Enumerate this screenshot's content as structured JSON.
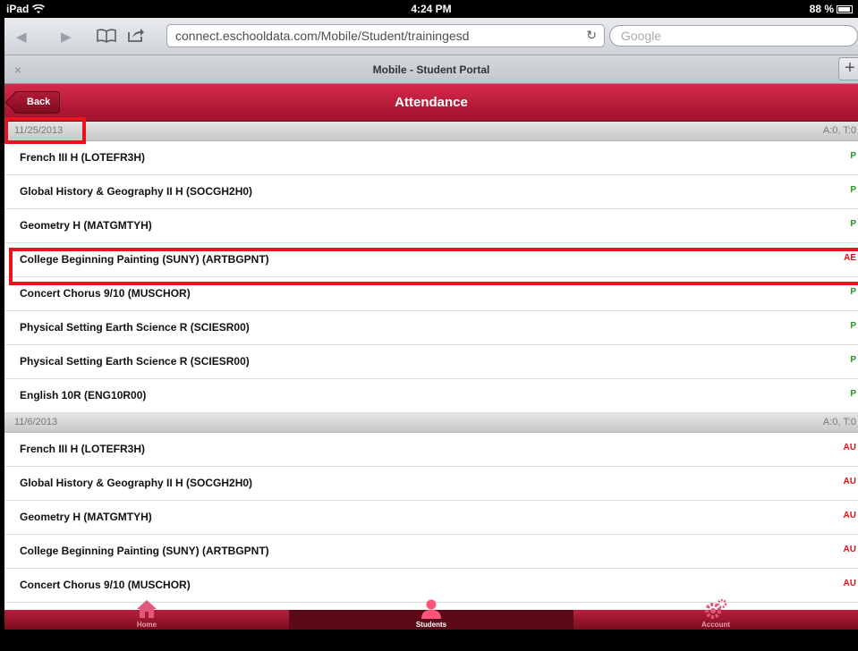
{
  "status_bar": {
    "device": "iPad",
    "time": "4:24 PM",
    "battery": "88 %"
  },
  "browser": {
    "url": "connect.eschooldata.com/Mobile/Student/trainingesd",
    "search_placeholder": "Google",
    "tab_title": "Mobile - Student Portal",
    "tab_close": "×",
    "tab_new": "+"
  },
  "header": {
    "back_label": "Back",
    "title": "Attendance"
  },
  "groups": [
    {
      "date": "11/25/2013",
      "summary": "A:0, T:0",
      "rows": [
        {
          "course": "French III H (LOTEFR3H)",
          "code": "P"
        },
        {
          "course": "Global History & Geography II H (SOCGH2H0)",
          "code": "P"
        },
        {
          "course": "Geometry H (MATGMTYH)",
          "code": "P"
        },
        {
          "course": "College Beginning Painting (SUNY) (ARTBGPNT)",
          "code": "AE"
        },
        {
          "course": "Concert Chorus 9/10 (MUSCHOR)",
          "code": "P"
        },
        {
          "course": "Physical Setting Earth Science R (SCIESR00)",
          "code": "P"
        },
        {
          "course": "Physical Setting Earth Science R (SCIESR00)",
          "code": "P"
        },
        {
          "course": "English 10R (ENG10R00)",
          "code": "P"
        }
      ]
    },
    {
      "date": "11/6/2013",
      "summary": "A:0, T:0",
      "rows": [
        {
          "course": "French III H (LOTEFR3H)",
          "code": "AU"
        },
        {
          "course": "Global History & Geography II H (SOCGH2H0)",
          "code": "AU"
        },
        {
          "course": "Geometry H (MATGMTYH)",
          "code": "AU"
        },
        {
          "course": "College Beginning Painting (SUNY) (ARTBGPNT)",
          "code": "AU"
        },
        {
          "course": "Concert Chorus 9/10 (MUSCHOR)",
          "code": "AU"
        }
      ]
    }
  ],
  "tabs": [
    {
      "label": "Home",
      "icon": "home-icon"
    },
    {
      "label": "Students",
      "icon": "student-icon"
    },
    {
      "label": "Account",
      "icon": "gears-icon"
    }
  ],
  "colors": {
    "brand": "#c41e3a",
    "present": "#1f9a22",
    "absent": "#e0101a",
    "highlight": "#e8141c"
  }
}
